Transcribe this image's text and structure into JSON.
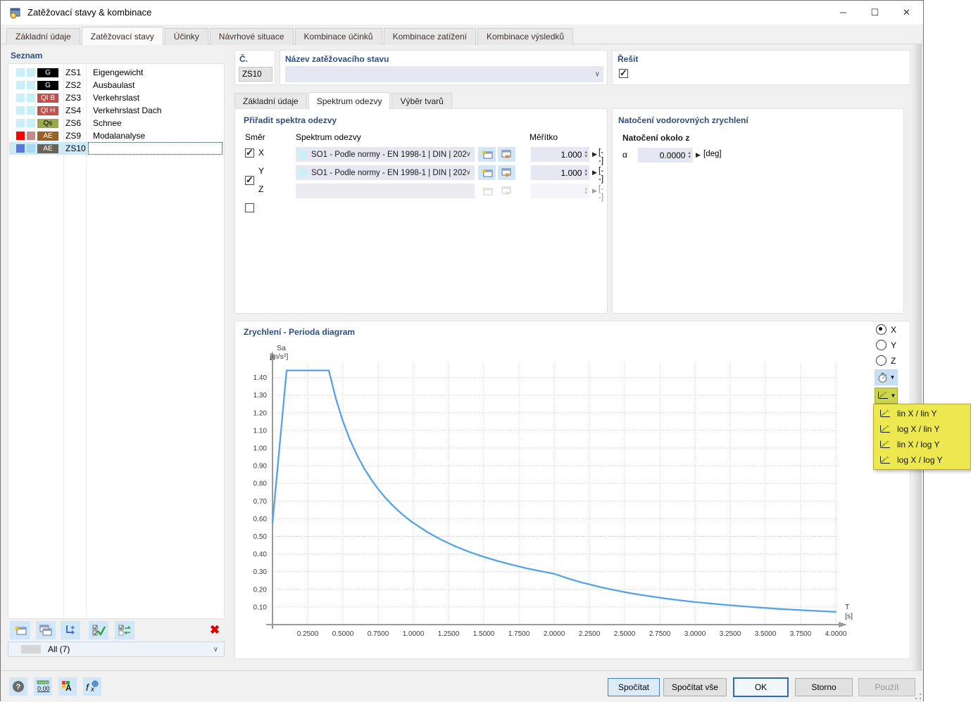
{
  "window": {
    "title": "Zatěžovací stavy & kombinace"
  },
  "main_tabs": {
    "items": [
      {
        "label": "Základní údaje"
      },
      {
        "label": "Zatěžovací stavy"
      },
      {
        "label": "Účinky"
      },
      {
        "label": "Návrhové situace"
      },
      {
        "label": "Kombinace účinků"
      },
      {
        "label": "Kombinace zatížení"
      },
      {
        "label": "Kombinace výsledků"
      }
    ],
    "active": "Zatěžovací stavy"
  },
  "list_panel": {
    "heading": "Seznam",
    "rows": [
      {
        "c1": "#C9F0F8",
        "c2": "#C9F0F8",
        "badge": "G",
        "badge_bg": "#000000",
        "badge_fg": "#FFFFFF",
        "id": "ZS1",
        "name": "Eigengewicht"
      },
      {
        "c1": "#C9F0F8",
        "c2": "#C9F0F8",
        "badge": "G",
        "badge_bg": "#000000",
        "badge_fg": "#FFFFFF",
        "id": "ZS2",
        "name": "Ausbaulast"
      },
      {
        "c1": "#C9F0F8",
        "c2": "#C9F0F8",
        "badge": "QI B",
        "badge_bg": "#C0504D",
        "badge_fg": "#FFFFFF",
        "id": "ZS3",
        "name": "Verkehrslast"
      },
      {
        "c1": "#C9F0F8",
        "c2": "#C9F0F8",
        "badge": "QI H",
        "badge_bg": "#C0504D",
        "badge_fg": "#FFFFFF",
        "id": "ZS4",
        "name": "Verkehrslast Dach"
      },
      {
        "c1": "#C9F0F8",
        "c2": "#C9F0F8",
        "badge": "Qs",
        "badge_bg": "#9CA84E",
        "badge_fg": "#000000",
        "id": "ZS6",
        "name": "Schnee"
      },
      {
        "c1": "#FF0000",
        "c2": "#C18A8E",
        "badge": "AE",
        "badge_bg": "#9A6026",
        "badge_fg": "#FFFFFF",
        "id": "ZS9",
        "name": "Modalanalyse"
      },
      {
        "c1": "#5B77DE",
        "c2": "#A7D9EF",
        "badge": "AE",
        "badge_bg": "#6B6357",
        "badge_fg": "#FFFFFF",
        "id": "ZS10",
        "name": ""
      }
    ],
    "selected_id": "ZS10",
    "filter_value": "All (7)"
  },
  "header": {
    "number_label": "Č.",
    "number_value": "ZS10",
    "name_label": "Název zatěžovacího stavu",
    "name_value": "",
    "solve_label": "Řešit",
    "solve_checked": true
  },
  "sub_tabs": {
    "items": [
      {
        "label": "Základní údaje"
      },
      {
        "label": "Spektrum odezvy"
      },
      {
        "label": "Výběr tvarů"
      }
    ],
    "active": "Spektrum odezvy"
  },
  "spectra": {
    "heading": "Přiřadit spektra odezvy",
    "dir_header": "Směr",
    "spectrum_header": "Spektrum odezvy",
    "scale_header": "Měřítko",
    "rows": [
      {
        "dir": "X",
        "checked": true,
        "spectrum": "SO1 - Podle normy - EN 1998-1 | DIN | 202...",
        "scale": "1.000",
        "unit": "[--]"
      },
      {
        "dir": "Y",
        "checked": true,
        "spectrum": "SO1 - Podle normy - EN 1998-1 | DIN | 202...",
        "scale": "1.000",
        "unit": "[--]"
      },
      {
        "dir": "Z",
        "checked": false,
        "spectrum": "",
        "scale": "",
        "unit": "[--]"
      }
    ]
  },
  "rotation": {
    "heading": "Natočení vodorovných zrychlení",
    "sub_heading": "Natočení okolo z",
    "alpha_label": "α",
    "value": "0.0000",
    "unit": "[deg]"
  },
  "chart": {
    "title": "Zrychlení - Perioda diagram",
    "radio_x": "X",
    "radio_y": "Y",
    "radio_z": "Z",
    "scale_menu": [
      {
        "label": "lin X / lin Y"
      },
      {
        "label": "log X / lin Y"
      },
      {
        "label": "lin X / log Y"
      },
      {
        "label": "log X / log Y"
      }
    ]
  },
  "chart_data": {
    "type": "line",
    "title": "Zrychlení - Perioda diagram",
    "xlabel": "T",
    "x_unit": "[s]",
    "ylabel": "Sa",
    "y_unit": "[m/s²]",
    "xlim": [
      0,
      4.2
    ],
    "ylim": [
      0,
      1.5
    ],
    "grid": true,
    "x_ticks": [
      "0.2500",
      "0.5000",
      "0.7500",
      "1.0000",
      "1.2500",
      "1.5000",
      "1.7500",
      "2.0000",
      "2.2500",
      "2.5000",
      "2.7500",
      "3.0000",
      "3.2500",
      "3.5000",
      "3.7500",
      "4.0000"
    ],
    "y_ticks": [
      "0.10",
      "0.20",
      "0.30",
      "0.40",
      "0.50",
      "0.60",
      "0.70",
      "0.80",
      "0.90",
      "1.00",
      "1.10",
      "1.20",
      "1.30",
      "1.40"
    ],
    "series": [
      {
        "name": "X",
        "color": "#54A2E8",
        "points": [
          [
            0,
            0.576
          ],
          [
            0.05,
            1.008
          ],
          [
            0.1,
            1.44
          ],
          [
            0.4,
            1.44
          ],
          [
            0.45,
            1.28
          ],
          [
            0.5,
            1.152
          ],
          [
            0.55,
            1.047
          ],
          [
            0.6,
            0.96
          ],
          [
            0.65,
            0.886
          ],
          [
            0.7,
            0.823
          ],
          [
            0.75,
            0.768
          ],
          [
            0.8,
            0.72
          ],
          [
            0.85,
            0.678
          ],
          [
            0.9,
            0.64
          ],
          [
            0.95,
            0.606
          ],
          [
            1.0,
            0.576
          ],
          [
            1.1,
            0.524
          ],
          [
            1.2,
            0.48
          ],
          [
            1.3,
            0.443
          ],
          [
            1.4,
            0.411
          ],
          [
            1.5,
            0.384
          ],
          [
            1.6,
            0.36
          ],
          [
            1.7,
            0.339
          ],
          [
            1.8,
            0.32
          ],
          [
            1.9,
            0.303
          ],
          [
            2.0,
            0.288
          ],
          [
            2.1,
            0.261
          ],
          [
            2.2,
            0.238
          ],
          [
            2.3,
            0.218
          ],
          [
            2.4,
            0.2
          ],
          [
            2.5,
            0.184
          ],
          [
            2.6,
            0.17
          ],
          [
            2.7,
            0.158
          ],
          [
            2.8,
            0.147
          ],
          [
            2.9,
            0.137
          ],
          [
            3.0,
            0.128
          ],
          [
            3.2,
            0.113
          ],
          [
            3.4,
            0.1
          ],
          [
            3.6,
            0.089
          ],
          [
            3.8,
            0.08
          ],
          [
            4.0,
            0.072
          ]
        ]
      }
    ]
  },
  "footer": {
    "calculate": "Spočítat",
    "calculate_all": "Spočítat vše",
    "ok": "OK",
    "cancel": "Storno",
    "apply": "Použít"
  }
}
